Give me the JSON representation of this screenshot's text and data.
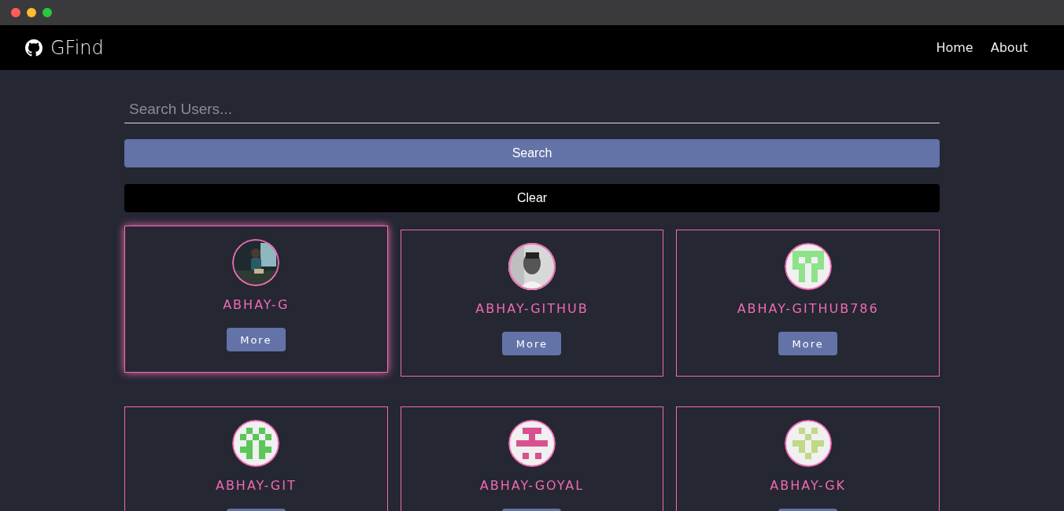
{
  "navbar": {
    "brand": "GFind",
    "links": [
      {
        "label": "Home"
      },
      {
        "label": "About"
      }
    ]
  },
  "search": {
    "placeholder": "Search Users...",
    "search_button": "Search",
    "clear_button": "Clear"
  },
  "users": [
    {
      "login": "ABHAY-G",
      "button": "More",
      "highlighted": true
    },
    {
      "login": "ABHAY-GITHUB",
      "button": "More",
      "highlighted": false
    },
    {
      "login": "ABHAY-GITHUB786",
      "avatar": {
        "kind": "identicon",
        "color": "#8ee28a"
      },
      "button": "More",
      "highlighted": false
    },
    {
      "login": "ABHAY-GIT",
      "avatar": {
        "kind": "identicon",
        "color": "#5cc65a"
      },
      "highlighted": false
    },
    {
      "login": "ABHAY-GOYAL",
      "avatar": {
        "kind": "identicon",
        "color": "#d9508f"
      },
      "highlighted": false
    },
    {
      "login": "ABHAY-GK",
      "avatar": {
        "kind": "identicon",
        "color": "#bfd985"
      },
      "highlighted": false
    }
  ]
}
